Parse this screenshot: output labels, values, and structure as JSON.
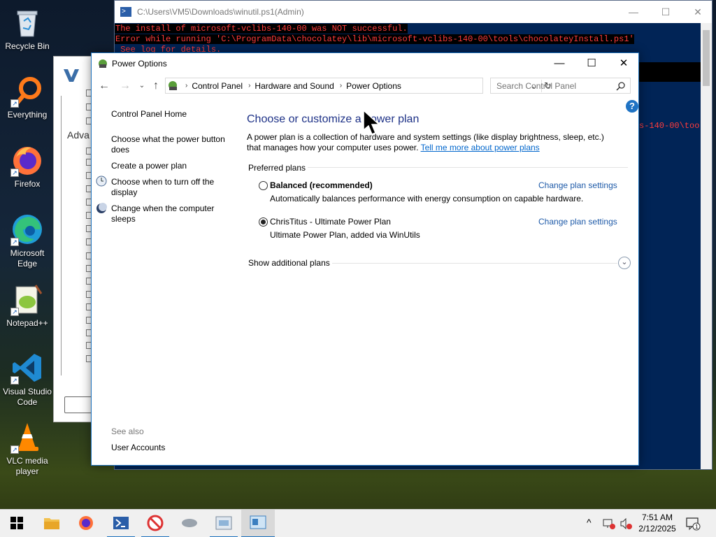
{
  "desktop": {
    "icons": [
      {
        "label": "Recycle Bin"
      },
      {
        "label": "Everything"
      },
      {
        "label": "Firefox"
      },
      {
        "label": "Microsoft Edge"
      },
      {
        "label": "Notepad++"
      },
      {
        "label": "Visual Studio Code"
      },
      {
        "label": "VLC media player"
      }
    ]
  },
  "powershell": {
    "title": "C:\\Users\\VM5\\Downloads\\winutil.ps1(Admin)",
    "lines": [
      "The install of microsoft-vclibs-140-00 was NOT successful.",
      "Error while running 'C:\\ProgramData\\chocolatey\\lib\\microsoft-vclibs-140-00\\tools\\chocolateyInstall.ps1'",
      " See log for details."
    ],
    "partial_right": "s-140-00\\tool"
  },
  "winutil": {
    "partial_heading": "Adva"
  },
  "power_options": {
    "title": "Power Options",
    "breadcrumb": [
      "Control Panel",
      "Hardware and Sound",
      "Power Options"
    ],
    "search_placeholder": "Search Control Panel",
    "left_pane": {
      "home": "Control Panel Home",
      "links": [
        "Choose what the power button does",
        "Create a power plan",
        "Choose when to turn off the display",
        "Change when the computer sleeps"
      ],
      "see_also": "See also",
      "user_accounts": "User Accounts"
    },
    "heading": "Choose or customize a power plan",
    "description": "A power plan is a collection of hardware and system settings (like display brightness, sleep, etc.) that manages how your computer uses power.",
    "learn_more": "Tell me more about power plans",
    "preferred_plans_label": "Preferred plans",
    "plans": [
      {
        "name": "Balanced (recommended)",
        "description": "Automatically balances performance with energy consumption on capable hardware.",
        "link": "Change plan settings",
        "selected": false
      },
      {
        "name": "ChrisTitus - Ultimate Power Plan",
        "description": "Ultimate Power Plan, added via WinUtils",
        "link": "Change plan settings",
        "selected": true
      }
    ],
    "show_additional": "Show additional plans"
  },
  "taskbar": {
    "time": "7:51 AM",
    "date": "2/12/2025",
    "notification_count": "1",
    "apps": [
      "file-explorer",
      "firefox",
      "powershell",
      "winutil",
      "mouse-settings",
      "control-panel-window",
      "power-options-window"
    ]
  },
  "colors": {
    "accent": "#1e73be",
    "heading": "#1e3287",
    "link": "#1e5aa8",
    "error_text": "#ff3b3b",
    "ps_background": "#012456"
  }
}
